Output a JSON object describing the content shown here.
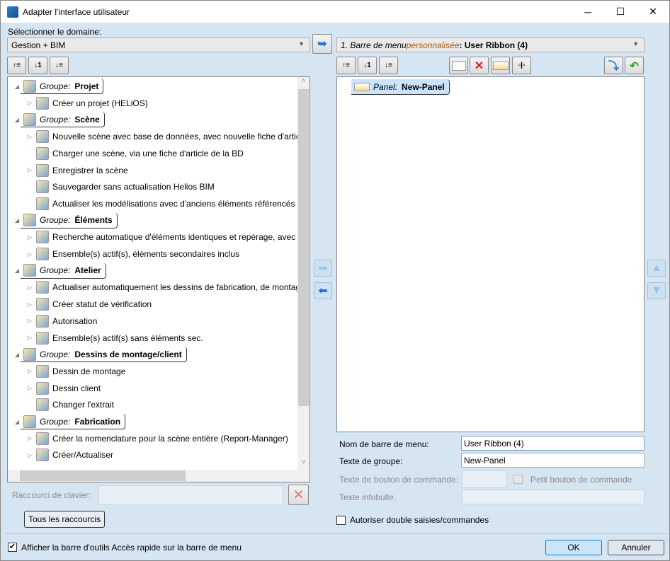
{
  "window": {
    "title": "Adapter l'interface utilisateur",
    "minimize": "─",
    "maximize": "☐",
    "close": "✕"
  },
  "left": {
    "domain_label": "Sélectionner le domaine:",
    "domain_value": "Gestion + BIM",
    "tree": [
      {
        "type": "group",
        "prefix": "Groupe:",
        "name": "Projet"
      },
      {
        "type": "item",
        "label": "Créer un projet (HELiOS)",
        "expandable": true
      },
      {
        "type": "group",
        "prefix": "Groupe:",
        "name": "Scène"
      },
      {
        "type": "item",
        "label": "Nouvelle scène avec base de données, avec nouvelle fiche d'article",
        "expandable": true
      },
      {
        "type": "item",
        "label": "Charger une scène, via une fiche d'article de la BD",
        "expandable": false
      },
      {
        "type": "item",
        "label": "Enregistrer la scène",
        "expandable": true
      },
      {
        "type": "item",
        "label": "Sauvegarder sans actualisation Helios BIM",
        "expandable": false
      },
      {
        "type": "item",
        "label": "Actualiser les modélisations avec d'anciens éléments référencés",
        "expandable": false
      },
      {
        "type": "group",
        "prefix": "Groupe:",
        "name": "Éléments"
      },
      {
        "type": "item",
        "label": "Recherche automatique d'éléments identiques et repérage, avec",
        "expandable": true
      },
      {
        "type": "item",
        "label": "Ensemble(s) actif(s), éléments secondaires inclus",
        "expandable": true
      },
      {
        "type": "group",
        "prefix": "Groupe:",
        "name": "Atelier"
      },
      {
        "type": "item",
        "label": "Actualiser automatiquement les dessins de fabrication, de montage",
        "expandable": true
      },
      {
        "type": "item",
        "label": "Créer statut de vérification",
        "expandable": true
      },
      {
        "type": "item",
        "label": "Autorisation",
        "expandable": true
      },
      {
        "type": "item",
        "label": "Ensemble(s) actif(s) sans éléments sec.",
        "expandable": true
      },
      {
        "type": "group",
        "prefix": "Groupe:",
        "name": "Dessins de montage/client"
      },
      {
        "type": "item",
        "label": "Dessin de montage",
        "expandable": true
      },
      {
        "type": "item",
        "label": "Dessin client",
        "expandable": true
      },
      {
        "type": "item",
        "label": "Changer l'extrait",
        "expandable": false
      },
      {
        "type": "group",
        "prefix": "Groupe:",
        "name": "Fabrication"
      },
      {
        "type": "item",
        "label": "Créer la nomenclature pour la scène entière (Report-Manager)",
        "expandable": true
      },
      {
        "type": "item",
        "label": "Créer/Actualiser",
        "expandable": true
      }
    ],
    "shortcut_label": "Raccourci de clavier:",
    "shortcut_value": "",
    "all_shortcuts": "Tous les raccourcis"
  },
  "right": {
    "ribbon_prefix": "1. Barre de menu ",
    "ribbon_custom": "personnalisée",
    "ribbon_name": ": User Ribbon (4)",
    "tree": [
      {
        "prefix": "Panel:",
        "name": "New-Panel"
      }
    ],
    "fields": {
      "ribbon_name_label": "Nom de barre de menu:",
      "ribbon_name_value": "User Ribbon (4)",
      "group_text_label": "Texte de groupe:",
      "group_text_value": "New-Panel",
      "cmd_text_label": "Texte de bouton de commande:",
      "cmd_text_value": "",
      "small_btn_label": "Petit bouton de commande",
      "tooltip_label": "Texte infobulle:",
      "tooltip_value": ""
    },
    "allow_double_label": "Autoriser double saisies/commandes",
    "allow_double_checked": false
  },
  "footer": {
    "quick_access_label": "Afficher la barre d'outils Accès rapide sur la barre de menu",
    "quick_access_checked": true,
    "ok": "OK",
    "cancel": "Annuler"
  }
}
